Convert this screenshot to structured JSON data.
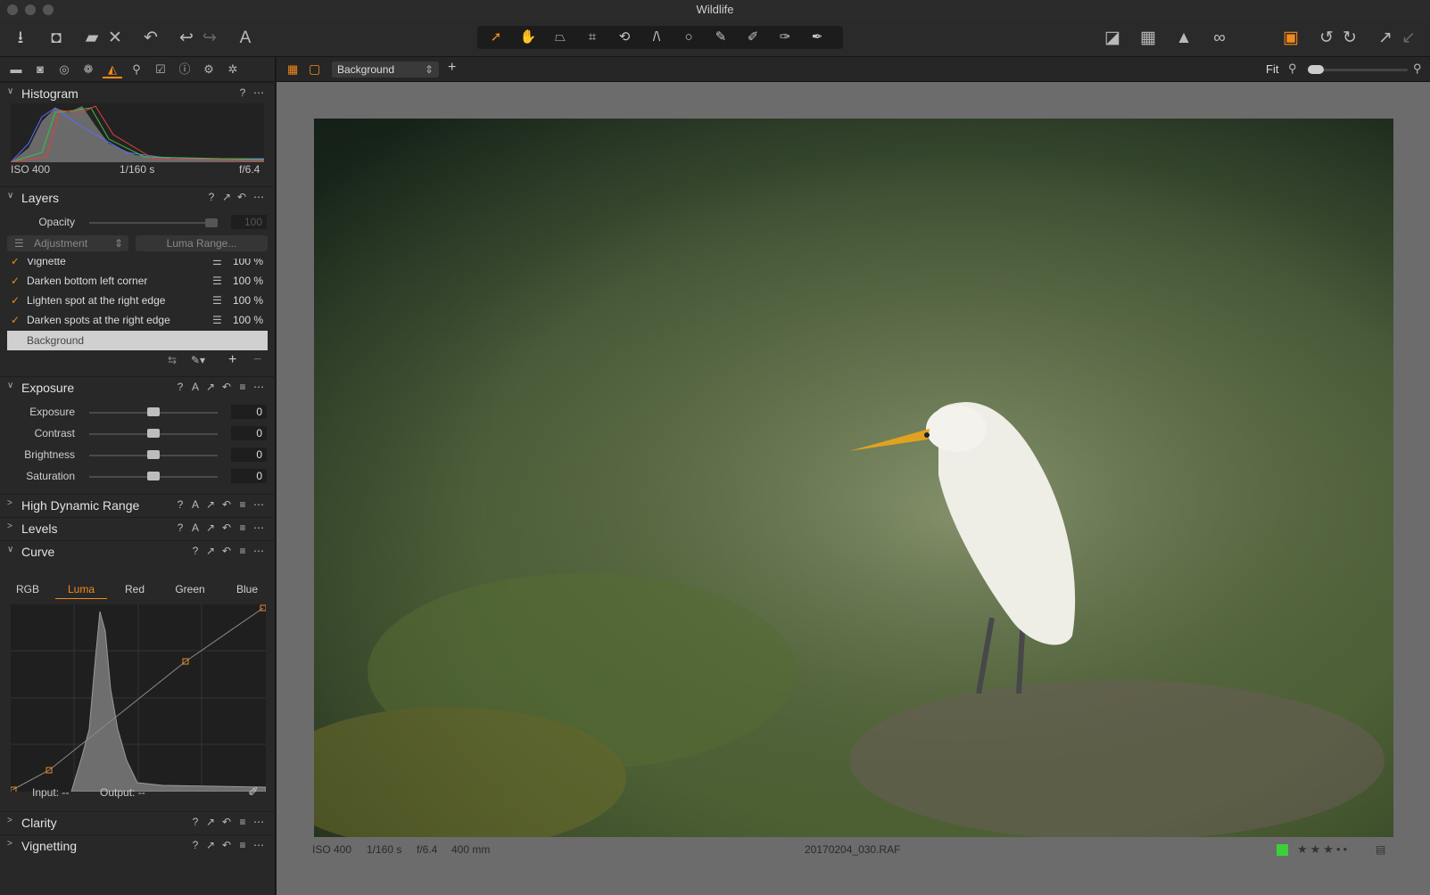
{
  "window": {
    "title": "Wildlife"
  },
  "toolbar": {
    "cursor_icons": [
      "pointer-tool-icon",
      "pan-tool-icon",
      "keystone-tool-icon",
      "crop-tool-icon",
      "rotate-tool-icon",
      "straighten-tool-icon",
      "spot-tool-icon",
      "brush-tool-icon",
      "erase-tool-icon",
      "gradient-tool-icon",
      "pen-tool-icon"
    ]
  },
  "sidebar": {
    "tab_icons": [
      "library-icon",
      "capture-icon",
      "lens-icon",
      "color-icon",
      "exposure-tab-icon",
      "details-icon",
      "adjustments-icon",
      "metadata-icon",
      "output-icon",
      "batch-icon"
    ],
    "histogram": {
      "title": "Histogram",
      "iso": "ISO 400",
      "shutter": "1/160 s",
      "aperture": "f/6.4"
    },
    "layers": {
      "title": "Layers",
      "opacity_label": "Opacity",
      "opacity_value": "100",
      "adjustment_select": "Adjustment",
      "luma_button": "Luma Range...",
      "items": [
        {
          "name": "Vignette",
          "pct": "100 %"
        },
        {
          "name": "Darken bottom left corner",
          "pct": "100 %"
        },
        {
          "name": "Lighten spot at the right edge",
          "pct": "100 %"
        },
        {
          "name": "Darken spots at the right edge",
          "pct": "100 %"
        }
      ],
      "background": "Background"
    },
    "exposure": {
      "title": "Exposure",
      "sliders": [
        {
          "label": "Exposure",
          "value": "0"
        },
        {
          "label": "Contrast",
          "value": "0"
        },
        {
          "label": "Brightness",
          "value": "0"
        },
        {
          "label": "Saturation",
          "value": "0"
        }
      ]
    },
    "hdr": {
      "title": "High Dynamic Range"
    },
    "levels": {
      "title": "Levels"
    },
    "curve": {
      "title": "Curve",
      "tabs": [
        "RGB",
        "Luma",
        "Red",
        "Green",
        "Blue"
      ],
      "active_tab": "Luma",
      "input_label": "Input:",
      "input_value": "--",
      "output_label": "Output:",
      "output_value": "--"
    },
    "clarity": {
      "title": "Clarity"
    },
    "vignetting": {
      "title": "Vignetting"
    }
  },
  "viewer": {
    "layer_select": "Background",
    "zoom_label": "Fit",
    "meta": {
      "iso": "ISO 400",
      "shutter": "1/160 s",
      "aperture": "f/6.4",
      "focal": "400 mm",
      "filename": "20170204_030.RAF"
    },
    "color_label": "#3ccf3c",
    "rating": 3
  }
}
